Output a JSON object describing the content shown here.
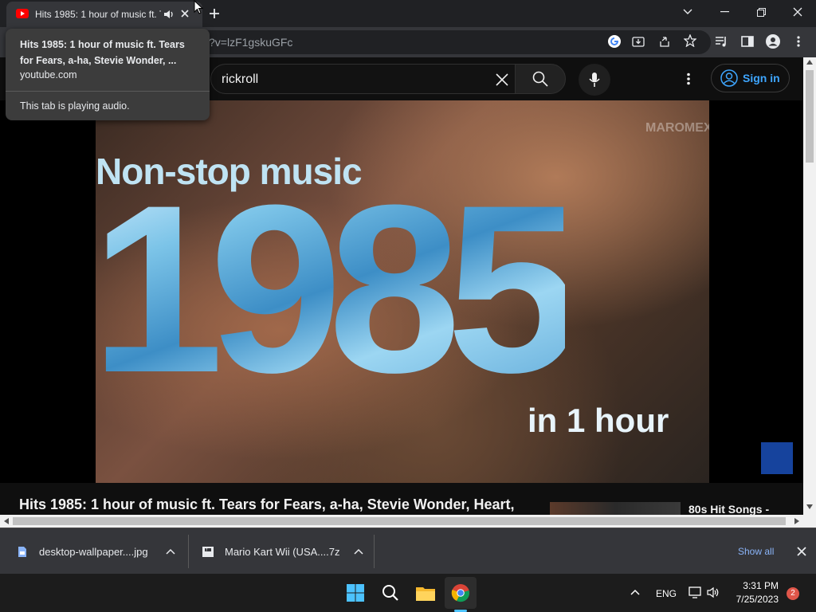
{
  "browser": {
    "tab_title": "Hits 1985: 1 hour of music ft. Tears for Fears, a-ha, Stevie Wonder, Heart,",
    "url_partial": "?v=lzF1gskuGFc",
    "hover_card": {
      "title": "Hits 1985: 1 hour of music ft. Tears for Fears, a-ha, Stevie Wonder, ...",
      "domain": "youtube.com",
      "audio_notice": "This tab is playing audio."
    }
  },
  "youtube": {
    "search_query": "rickroll",
    "sign_in_label": "Sign in",
    "video": {
      "overlay_top": "Non-stop music",
      "overlay_big": "1985",
      "overlay_bottom": "in 1 hour",
      "watermark": "MAROMEX"
    },
    "video_title": "Hits 1985: 1 hour of music ft. Tears for Fears, a-ha, Stevie Wonder, Heart,",
    "recommendation_title": "80s Hit Songs -"
  },
  "downloads": {
    "items": [
      {
        "name": "desktop-wallpaper....jpg",
        "icon": "image-file-icon"
      },
      {
        "name": "Mario Kart Wii (USA....7z",
        "icon": "archive-file-icon"
      }
    ],
    "show_all_label": "Show all"
  },
  "taskbar": {
    "language": "ENG",
    "time": "3:31 PM",
    "date": "7/25/2023",
    "notification_count": "2"
  },
  "colors": {
    "youtube_red": "#ff0000",
    "link_blue": "#3ea6ff",
    "chrome_dark": "#35363a"
  }
}
